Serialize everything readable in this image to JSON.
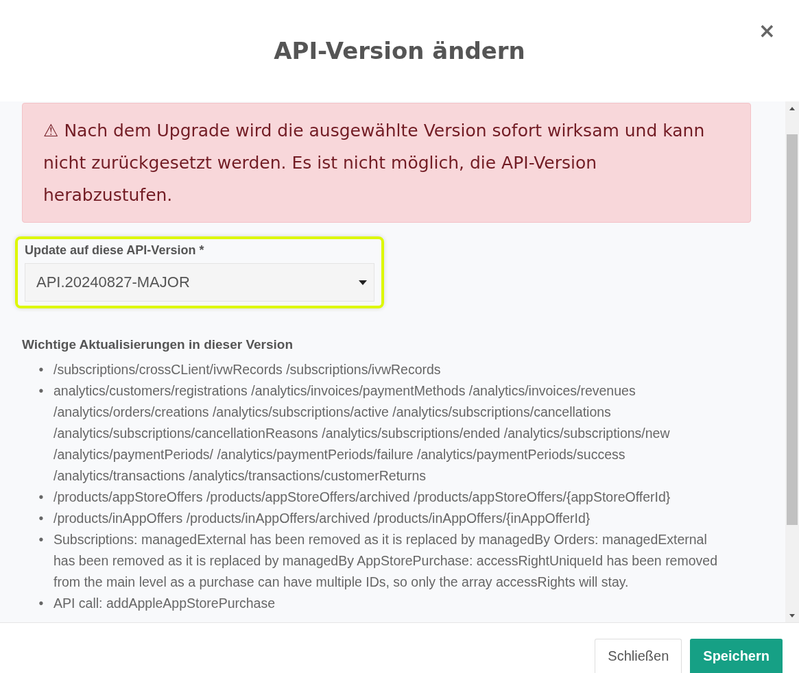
{
  "dialog": {
    "title": "API-Version ändern",
    "close": "×"
  },
  "alert": {
    "icon": "⚠",
    "text": "Nach dem Upgrade wird die ausgewählte Version sofort wirksam und kann nicht zurückgesetzt werden. Es ist nicht möglich, die API-Version herabzustufen."
  },
  "version_field": {
    "label": "Update auf diese API-Version",
    "required_mark": "*",
    "value": "API.20240827-MAJOR",
    "highlighted": true
  },
  "updates": {
    "heading": "Wichtige Aktualisierungen in dieser Version",
    "items": [
      {
        "marker": "•",
        "text": "/subscriptions/crossCLient/ivwRecords /subscriptions/ivwRecords"
      },
      {
        "marker": "•",
        "text": "analytics/customers/registrations /analytics/invoices/paymentMethods /analytics/invoices/revenues /analytics/orders/creations /analytics/subscriptions/active /analytics/subscriptions/cancellations /analytics/subscriptions/cancellationReasons /analytics/subscriptions/ended /analytics/subscriptions/new /analytics/paymentPeriods/ /analytics/paymentPeriods/failure /analytics/paymentPeriods/success /analytics/transactions /analytics/transactions/customerReturns"
      },
      {
        "marker": "•",
        "text": "/products/appStoreOffers /products/appStoreOffers/archived /products/appStoreOffers/{appStoreOfferId}"
      },
      {
        "marker": "•",
        "text": "/products/inAppOffers /products/inAppOffers/archived /products/inAppOffers/{inAppOfferId}"
      },
      {
        "marker": "•",
        "text": "Subscriptions: managedExternal has been removed as it is replaced by managedBy Orders: managedExternal has been removed as it is replaced by managedBy AppStorePurchase: accessRightUniqueId has been removed from the main level as a purchase can have multiple IDs, so only the array accessRights will stay."
      },
      {
        "marker": "•",
        "text": "API call: addAppleAppStorePurchase"
      }
    ]
  },
  "buttons": [
    {
      "label": "Schließen",
      "kind": "secondary"
    },
    {
      "label": "Speichern",
      "kind": "primary"
    }
  ]
}
